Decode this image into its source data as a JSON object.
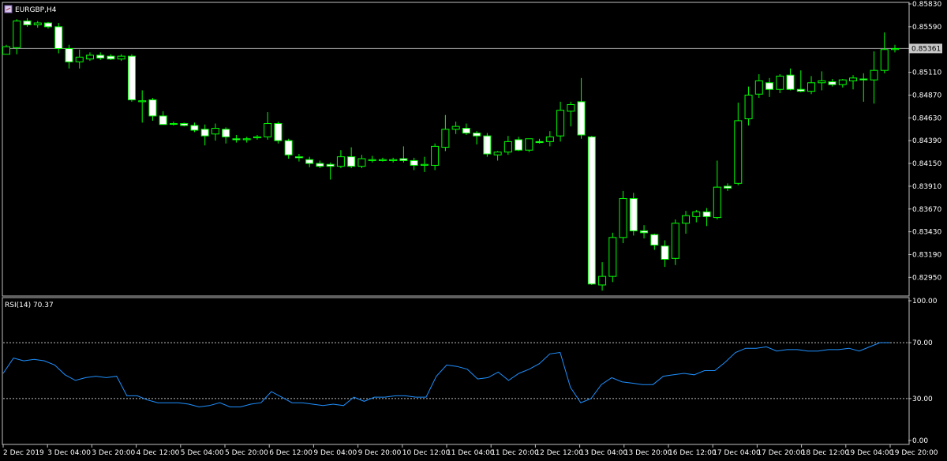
{
  "window": {
    "symbol_title": "EURGBP,H4",
    "icon": "chart-window-icon"
  },
  "colors": {
    "background": "#000000",
    "frame": "#c0c0c0",
    "bull_body": "#000000",
    "bull_wick": "#00ff00",
    "bear_body": "#ffffff",
    "bear_wick": "#00ff00",
    "price_line": "#a0a0a0",
    "rsi_line": "#1e90ff",
    "level_line": "#c0c0c0",
    "text": "#ffffff"
  },
  "current_price_label": "0.85361",
  "rsi_label": "RSI(14) 70.37",
  "chart_data": [
    {
      "type": "candlestick",
      "title": "EURGBP,H4",
      "ylim": [
        0.8277,
        0.8583
      ],
      "y_ticks": [
        "0.85830",
        "0.85590",
        "0.85361",
        "0.85110",
        "0.84870",
        "0.84630",
        "0.84390",
        "0.84150",
        "0.83910",
        "0.83670",
        "0.83430",
        "0.83190",
        "0.82950"
      ],
      "x_ticks": [
        "2 Dec 2019",
        "3 Dec 04:00",
        "3 Dec 20:00",
        "4 Dec 12:00",
        "5 Dec 04:00",
        "5 Dec 20:00",
        "6 Dec 12:00",
        "9 Dec 04:00",
        "9 Dec 20:00",
        "10 Dec 12:00",
        "11 Dec 04:00",
        "11 Dec 20:00",
        "12 Dec 12:00",
        "13 Dec 04:00",
        "13 Dec 20:00",
        "16 Dec 12:00",
        "17 Dec 04:00",
        "17 Dec 20:00",
        "18 Dec 12:00",
        "19 Dec 04:00",
        "19 Dec 20:00"
      ],
      "current_price": 0.85361,
      "candles": [
        [
          0.853,
          0.854,
          0.853,
          0.8538
        ],
        [
          0.8537,
          0.8567,
          0.853,
          0.8565
        ],
        [
          0.8565,
          0.8568,
          0.8559,
          0.8561
        ],
        [
          0.8561,
          0.8565,
          0.8558,
          0.8563
        ],
        [
          0.8563,
          0.8564,
          0.8557,
          0.8559
        ],
        [
          0.8559,
          0.8563,
          0.8531,
          0.8536
        ],
        [
          0.8536,
          0.854,
          0.8515,
          0.8522
        ],
        [
          0.8522,
          0.8535,
          0.8515,
          0.8527
        ],
        [
          0.8525,
          0.8532,
          0.8523,
          0.8529
        ],
        [
          0.8529,
          0.8532,
          0.8524,
          0.8526
        ],
        [
          0.8528,
          0.853,
          0.8524,
          0.8525
        ],
        [
          0.8525,
          0.853,
          0.8523,
          0.8528
        ],
        [
          0.8528,
          0.853,
          0.848,
          0.8482
        ],
        [
          0.848,
          0.8492,
          0.8458,
          0.8481
        ],
        [
          0.8482,
          0.8484,
          0.846,
          0.8465
        ],
        [
          0.8465,
          0.847,
          0.8458,
          0.8456
        ],
        [
          0.8457,
          0.8459,
          0.8455,
          0.8457
        ],
        [
          0.8457,
          0.8458,
          0.8454,
          0.8455
        ],
        [
          0.8455,
          0.8458,
          0.8448,
          0.845
        ],
        [
          0.8451,
          0.8456,
          0.8434,
          0.8444
        ],
        [
          0.8446,
          0.8457,
          0.8439,
          0.8452
        ],
        [
          0.8451,
          0.8453,
          0.8436,
          0.8443
        ],
        [
          0.8441,
          0.8445,
          0.8437,
          0.844
        ],
        [
          0.844,
          0.8443,
          0.8437,
          0.8441
        ],
        [
          0.8442,
          0.8445,
          0.844,
          0.8443
        ],
        [
          0.8443,
          0.8469,
          0.844,
          0.8457
        ],
        [
          0.8457,
          0.8459,
          0.8436,
          0.8439
        ],
        [
          0.8439,
          0.8441,
          0.842,
          0.8424
        ],
        [
          0.8422,
          0.8425,
          0.8417,
          0.8421
        ],
        [
          0.8419,
          0.8422,
          0.8411,
          0.8415
        ],
        [
          0.8415,
          0.8418,
          0.841,
          0.8412
        ],
        [
          0.8414,
          0.8416,
          0.8398,
          0.8412
        ],
        [
          0.8412,
          0.8429,
          0.841,
          0.8422
        ],
        [
          0.8422,
          0.8432,
          0.841,
          0.8412
        ],
        [
          0.8412,
          0.8424,
          0.841,
          0.842
        ],
        [
          0.8418,
          0.8423,
          0.8416,
          0.8419
        ],
        [
          0.8418,
          0.8421,
          0.8417,
          0.8419
        ],
        [
          0.8418,
          0.8421,
          0.8416,
          0.8419
        ],
        [
          0.842,
          0.8433,
          0.8416,
          0.8418
        ],
        [
          0.8418,
          0.8421,
          0.8408,
          0.8413
        ],
        [
          0.8413,
          0.8422,
          0.8406,
          0.8414
        ],
        [
          0.8413,
          0.8436,
          0.8408,
          0.8433
        ],
        [
          0.8432,
          0.8466,
          0.8428,
          0.8451
        ],
        [
          0.8451,
          0.8459,
          0.8446,
          0.8454
        ],
        [
          0.8452,
          0.8457,
          0.8445,
          0.8447
        ],
        [
          0.8447,
          0.8449,
          0.8435,
          0.8444
        ],
        [
          0.8444,
          0.8447,
          0.8422,
          0.8425
        ],
        [
          0.8424,
          0.8428,
          0.8418,
          0.8427
        ],
        [
          0.8427,
          0.8444,
          0.8424,
          0.8438
        ],
        [
          0.844,
          0.8443,
          0.8428,
          0.8429
        ],
        [
          0.8429,
          0.8441,
          0.8427,
          0.8441
        ],
        [
          0.8438,
          0.8441,
          0.8436,
          0.8437
        ],
        [
          0.8438,
          0.8449,
          0.8433,
          0.8443
        ],
        [
          0.8444,
          0.848,
          0.8438,
          0.8471
        ],
        [
          0.847,
          0.848,
          0.8454,
          0.8477
        ],
        [
          0.848,
          0.8505,
          0.8441,
          0.8445
        ],
        [
          0.8443,
          0.8444,
          0.8287,
          0.8288
        ],
        [
          0.8287,
          0.8311,
          0.8281,
          0.8296
        ],
        [
          0.8296,
          0.8342,
          0.829,
          0.8337
        ],
        [
          0.8337,
          0.8386,
          0.8331,
          0.8378
        ],
        [
          0.8378,
          0.8384,
          0.8339,
          0.8344
        ],
        [
          0.8344,
          0.835,
          0.8336,
          0.8342
        ],
        [
          0.834,
          0.8341,
          0.8324,
          0.8329
        ],
        [
          0.8328,
          0.8334,
          0.8306,
          0.8314
        ],
        [
          0.8315,
          0.8356,
          0.8308,
          0.8352
        ],
        [
          0.8352,
          0.8365,
          0.8341,
          0.836
        ],
        [
          0.8359,
          0.8366,
          0.8353,
          0.8364
        ],
        [
          0.8364,
          0.8368,
          0.8349,
          0.8359
        ],
        [
          0.8358,
          0.8418,
          0.8356,
          0.839
        ],
        [
          0.8391,
          0.8394,
          0.8386,
          0.8389
        ],
        [
          0.8394,
          0.8479,
          0.8392,
          0.846
        ],
        [
          0.8462,
          0.8496,
          0.8455,
          0.8487
        ],
        [
          0.8488,
          0.8509,
          0.8484,
          0.8502
        ],
        [
          0.85,
          0.8505,
          0.8485,
          0.8493
        ],
        [
          0.8493,
          0.8509,
          0.8489,
          0.8507
        ],
        [
          0.8508,
          0.8515,
          0.8492,
          0.8493
        ],
        [
          0.8493,
          0.8513,
          0.849,
          0.8491
        ],
        [
          0.8491,
          0.8507,
          0.8488,
          0.85
        ],
        [
          0.85,
          0.8512,
          0.8492,
          0.8502
        ],
        [
          0.8501,
          0.8504,
          0.8496,
          0.8498
        ],
        [
          0.8498,
          0.8504,
          0.8495,
          0.8503
        ],
        [
          0.8502,
          0.8508,
          0.8493,
          0.8505
        ],
        [
          0.8504,
          0.851,
          0.848,
          0.8503
        ],
        [
          0.8503,
          0.8533,
          0.8478,
          0.8513
        ],
        [
          0.8513,
          0.8553,
          0.851,
          0.8535
        ],
        [
          0.8535,
          0.854,
          0.8532,
          0.8536
        ]
      ]
    },
    {
      "type": "line",
      "title": "RSI(14) 70.37",
      "ylim": [
        0,
        100
      ],
      "y_ticks": [
        "100.00",
        "70.00",
        "30.00",
        "0.00"
      ],
      "levels": [
        70,
        30
      ],
      "series": [
        {
          "values": [
            48,
            59,
            57,
            58,
            57,
            54,
            47,
            43,
            45,
            46,
            45,
            46,
            32,
            32,
            29,
            27,
            27,
            27,
            26,
            24,
            25,
            27,
            24,
            24,
            26,
            27,
            35,
            31,
            27,
            27,
            26,
            25,
            26,
            25,
            31,
            28,
            31,
            31,
            32,
            32,
            31,
            31,
            46,
            54,
            53,
            51,
            44,
            45,
            49,
            43,
            48,
            51,
            55,
            62,
            63,
            38,
            27,
            30,
            40,
            45,
            42,
            41,
            40,
            40,
            46,
            47,
            48,
            47,
            50,
            50,
            56,
            63,
            66,
            66,
            67,
            64,
            65,
            65,
            64,
            64,
            65,
            65,
            66,
            64,
            67,
            70,
            70
          ]
        }
      ]
    }
  ]
}
